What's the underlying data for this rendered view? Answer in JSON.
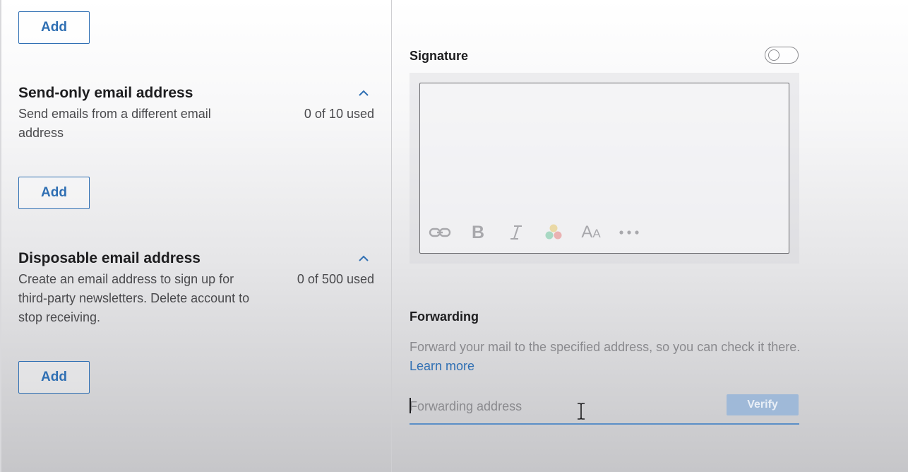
{
  "sections": {
    "top": {
      "add_label": "Add"
    },
    "send_only": {
      "title": "Send-only email address",
      "description": "Send emails from a different email address",
      "usage": "0 of 10 used",
      "add_label": "Add"
    },
    "disposable": {
      "title": "Disposable email address",
      "description": "Create an email address to sign up for third-party newsletters. Delete account to stop receiving.",
      "usage": "0 of 500 used",
      "add_label": "Add"
    }
  },
  "signature": {
    "title": "Signature",
    "enabled": false,
    "toolbar": [
      "link-icon",
      "bold-icon",
      "italic-icon",
      "color-icon",
      "font-size-icon",
      "more-icon"
    ]
  },
  "forwarding": {
    "title": "Forwarding",
    "description": "Forward your mail to the specified address, so you can check it there.",
    "learn_more": "Learn more",
    "placeholder": "Forwarding address",
    "value": "",
    "verify_label": "Verify"
  },
  "colors": {
    "accent": "#2f6fb3",
    "verify_disabled": "#9fb9d8",
    "input_underline": "#5b8fc7"
  }
}
